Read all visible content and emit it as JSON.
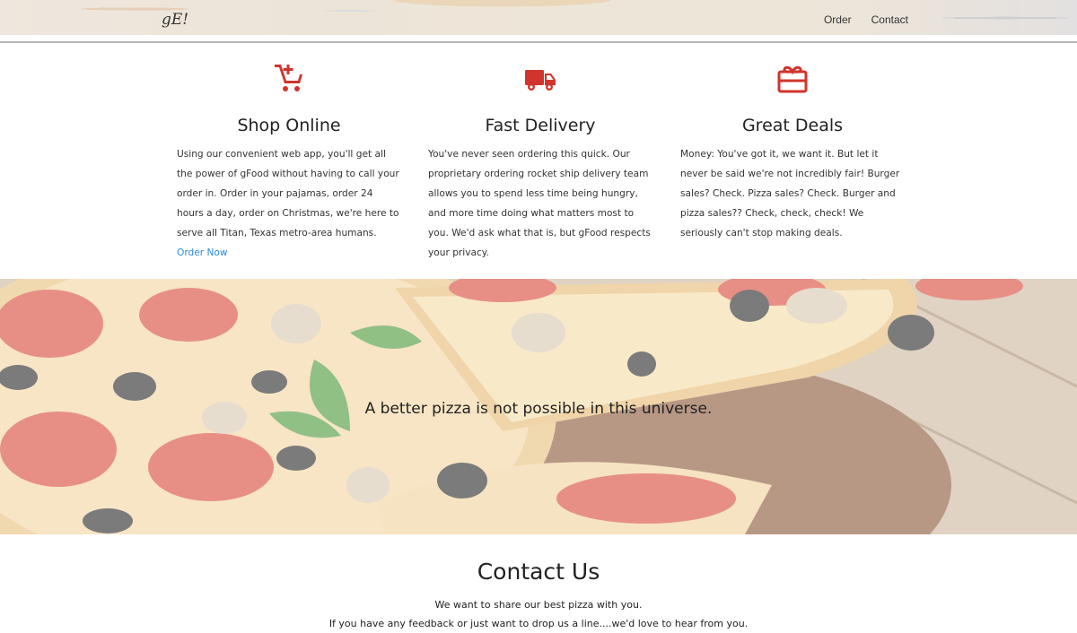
{
  "header": {
    "logo": "gE!",
    "nav": [
      "Order",
      "Contact"
    ]
  },
  "features": [
    {
      "icon": "cart-plus-icon",
      "title": "Shop Online",
      "text": "Using our convenient web app, you'll get all the power of gFood without having to call your order in. Order in your pajamas, order 24 hours a day, order on Christmas, we're here to serve all Titan, Texas metro-area humans.",
      "link": "Order Now"
    },
    {
      "icon": "truck-icon",
      "title": "Fast Delivery",
      "text": "You've never seen ordering this quick. Our proprietary ordering rocket ship delivery team allows you to spend less time being hungry, and more time doing what matters most to you. We'd ask what that is, but gFood respects your privacy."
    },
    {
      "icon": "gift-card-icon",
      "title": "Great Deals",
      "text": "Money: You've got it, we want it. But let it never be said we're not incredibly fair! Burger sales? Check. Pizza sales? Check. Burger and pizza sales?? Check, check, check! We seriously can't stop making deals."
    }
  ],
  "hero": {
    "tagline": "A better pizza is not possible in this universe."
  },
  "contact": {
    "title": "Contact Us",
    "line1": "We want to share our best pizza with you.",
    "line2": "If you have any feedback or just want to drop us a line....we'd love to hear from you."
  },
  "colors": {
    "accent": "#d0342c",
    "link": "#2d8ad9"
  }
}
